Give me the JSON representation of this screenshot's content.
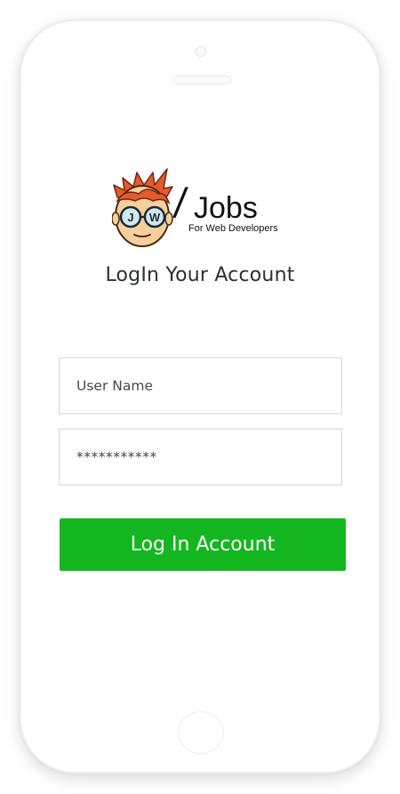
{
  "brand": {
    "name": "Jobs",
    "slash": "/",
    "tagline": "For Web Developers",
    "mascot_lenses": [
      "J",
      "W"
    ]
  },
  "login": {
    "title": "LogIn Your Account",
    "username_placeholder": "User Name",
    "password_value": "***********",
    "submit_label": "Log In Account"
  },
  "colors": {
    "button": "#14b71f",
    "title_text": "#2c2f36",
    "hair": "#e8592b"
  },
  "icons": {
    "logo_mascot": "boy-with-glasses-mascot-icon"
  }
}
